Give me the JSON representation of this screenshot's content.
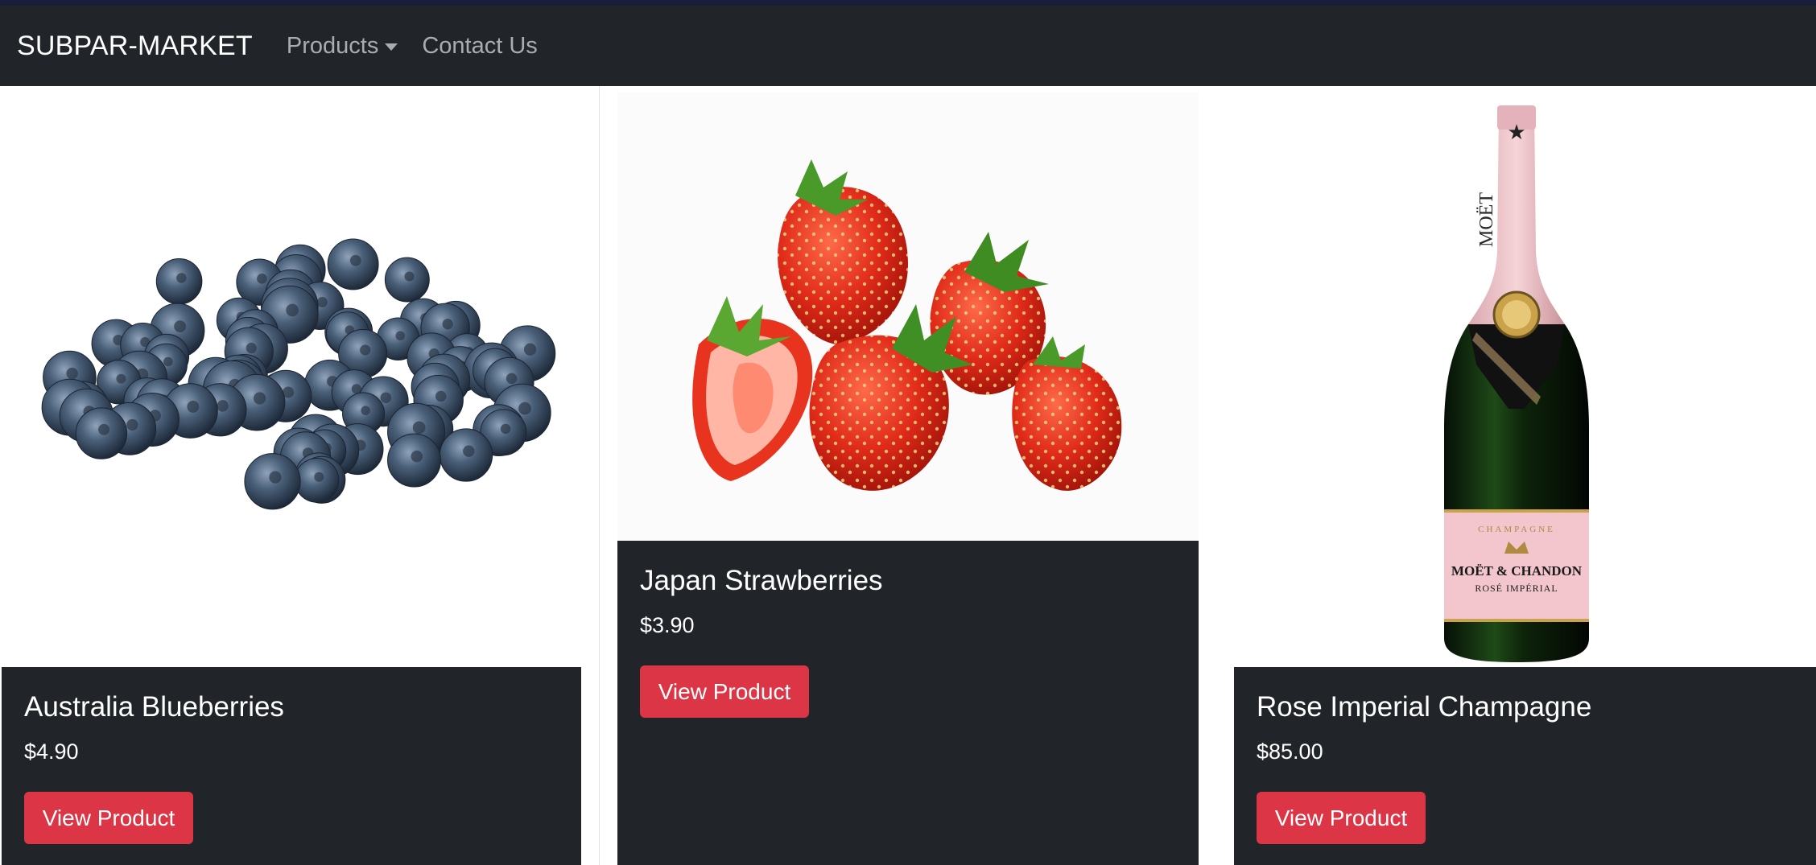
{
  "navbar": {
    "brand": "SUBPAR-MARKET",
    "items": [
      {
        "label": "Products",
        "has_dropdown": true
      },
      {
        "label": "Contact Us",
        "has_dropdown": false
      }
    ]
  },
  "products": [
    {
      "name": "Australia Blueberries",
      "price": "$4.90",
      "button_label": "View Product",
      "image": "blueberries"
    },
    {
      "name": "Japan Strawberries",
      "price": "$3.90",
      "button_label": "View Product",
      "image": "strawberries"
    },
    {
      "name": "Rose Imperial Champagne",
      "price": "$85.00",
      "button_label": "View Product",
      "image": "champagne-bottle"
    }
  ],
  "bottle_label": {
    "brand": "MOËT & CHANDON",
    "line": "ROSÉ IMPÉRIAL",
    "type": "CHAMPAGNE",
    "neck": "MOËT"
  },
  "colors": {
    "navbar_bg": "#212529",
    "card_body_bg": "#212529",
    "button_bg": "#dc3545",
    "nav_link": "#a9adb2"
  }
}
